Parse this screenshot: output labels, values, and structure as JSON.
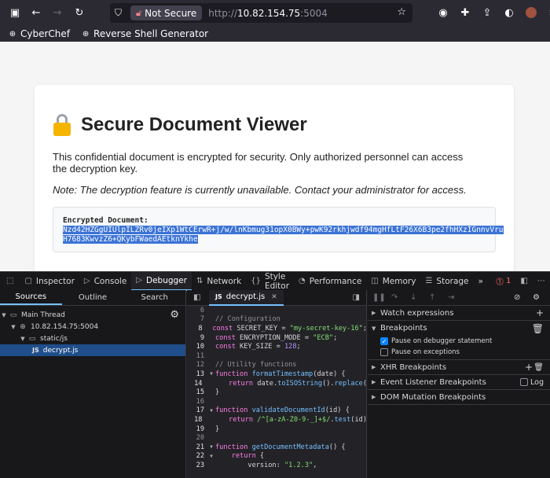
{
  "browser": {
    "security_label": "Not Secure",
    "url_prefix": "http://",
    "url_host": "10.82.154.75",
    "url_port": ":5004"
  },
  "bookmarks": [
    {
      "label": "CyberChef",
      "icon": "globe-icon"
    },
    {
      "label": "Reverse Shell Generator",
      "icon": "globe-icon"
    }
  ],
  "page": {
    "title": "Secure Document Viewer",
    "description": "This confidential document is encrypted for security. Only authorized personnel can access the decryption key.",
    "note": "Note: The decryption feature is currently unavailable. Contact your administrator for access.",
    "encrypted_label": "Encrypted Document:",
    "encrypted_line1": "Nzd42HZGgUIUlpILZRv0jeIXp1WtCErwR+j/w/lnKbmug31opX0BWy+pwK92rkhjwdf94mgHfLtF26X6B3pe2fhHXzIGnnvVru",
    "encrypted_line2": "H7683KwvzZ6+QKybFWaedAEtknYkhe"
  },
  "devtools": {
    "tabs": [
      "Inspector",
      "Console",
      "Debugger",
      "Network",
      "Style Editor",
      "Performance",
      "Memory",
      "Storage"
    ],
    "active_tab": "Debugger",
    "more": "»",
    "error_count": "1",
    "source_tabs": [
      "Sources",
      "Outline",
      "Search"
    ],
    "tree": {
      "thread": "Main Thread",
      "host": "10.82.154.75:5004",
      "folder": "static/js",
      "file": "decrypt.js"
    },
    "editor_tab": "decrypt.js",
    "code_lines": [
      {
        "n": "6",
        "text": ""
      },
      {
        "n": "7",
        "text": "// Configuration"
      },
      {
        "n": "8",
        "text": "const SECRET_KEY = \"my-secret-key-16\";"
      },
      {
        "n": "9",
        "text": "const ENCRYPTION_MODE = \"ECB\";"
      },
      {
        "n": "10",
        "text": "const KEY_SIZE = 128;"
      },
      {
        "n": "11",
        "text": ""
      },
      {
        "n": "12",
        "text": "// Utility functions"
      },
      {
        "n": "13",
        "text": "function formatTimestamp(date) {"
      },
      {
        "n": "14",
        "text": "    return date.toISOString().replace("
      },
      {
        "n": "15",
        "text": "}"
      },
      {
        "n": "16",
        "text": ""
      },
      {
        "n": "17",
        "text": "function validateDocumentId(id) {"
      },
      {
        "n": "18",
        "text": "    return /^[a-zA-Z0-9-_]+$/.test(id)"
      },
      {
        "n": "19",
        "text": "}"
      },
      {
        "n": "20",
        "text": ""
      },
      {
        "n": "21",
        "text": "function getDocumentMetadata() {"
      },
      {
        "n": "22",
        "text": "    return {"
      },
      {
        "n": "23",
        "text": "        version: \"1.2.3\","
      }
    ],
    "right_panel": {
      "watch": "Watch expressions",
      "breakpoints": "Breakpoints",
      "pause_debugger": "Pause on debugger statement",
      "pause_exceptions": "Pause on exceptions",
      "xhr": "XHR Breakpoints",
      "event_listener": "Event Listener Breakpoints",
      "log": "Log",
      "dom_mutation": "DOM Mutation Breakpoints"
    }
  }
}
